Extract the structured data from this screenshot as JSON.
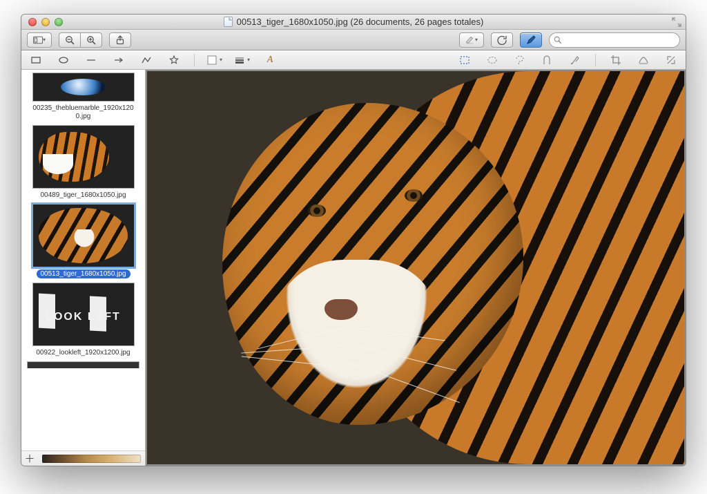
{
  "window": {
    "title": "00513_tiger_1680x1050.jpg (26 documents, 26 pages totales)"
  },
  "toolbar": {
    "search_placeholder": ""
  },
  "sidebar": {
    "thumbnails": [
      {
        "label": "00235_thebluemarble_1920x1200.jpg",
        "selected": false,
        "art": "earth"
      },
      {
        "label": "00489_tiger_1680x1050.jpg",
        "selected": false,
        "art": "tigerthumb"
      },
      {
        "label": "00513_tiger_1680x1050.jpg",
        "selected": true,
        "art": "tiger2"
      },
      {
        "label": "00922_lookleft_1920x1200.jpg",
        "selected": false,
        "art": "lookleft"
      }
    ]
  }
}
